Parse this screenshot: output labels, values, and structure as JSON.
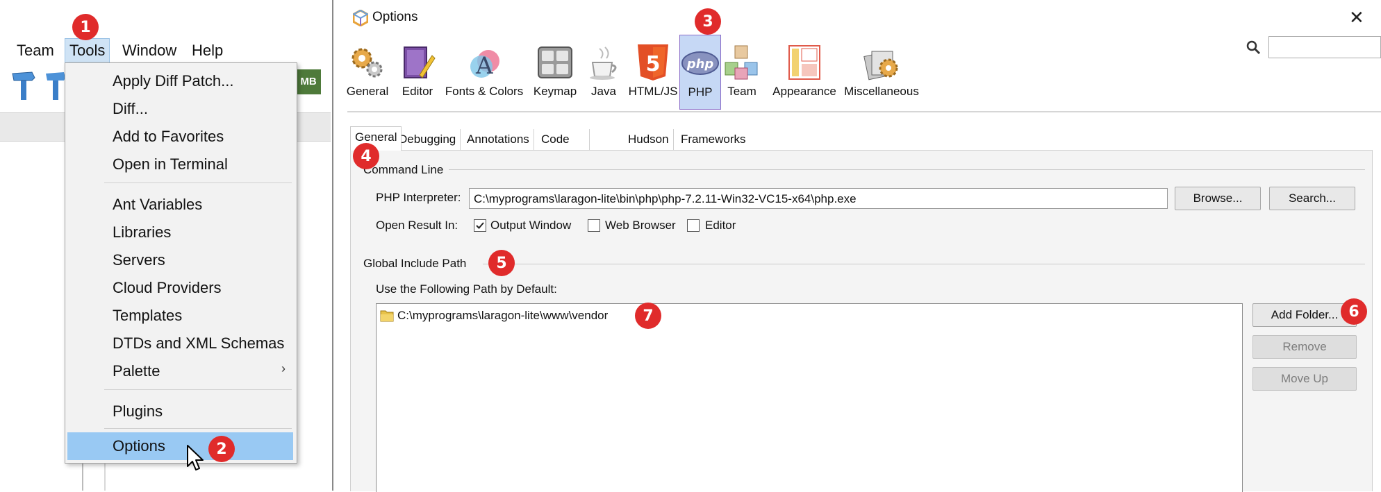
{
  "menubar": {
    "items": [
      "Team",
      "Tools",
      "Window",
      "Help"
    ],
    "active": "Tools"
  },
  "tools_menu": {
    "groups": [
      [
        "Apply Diff Patch...",
        "Diff...",
        "Add to Favorites",
        "Open in Terminal"
      ],
      [
        "Ant Variables",
        "Libraries",
        "Servers",
        "Cloud Providers",
        "Templates",
        "DTDs and XML Schemas",
        "Palette"
      ],
      [
        "Plugins"
      ],
      [
        "Options"
      ]
    ],
    "submenu_arrow": "›",
    "selected": "Options"
  },
  "toolbar": {
    "memory_label": "MB"
  },
  "dialog": {
    "title": "Options",
    "close": "✕",
    "categories": [
      "General",
      "Editor",
      "Fonts & Colors",
      "Keymap",
      "Java",
      "HTML/JS",
      "PHP",
      "Team",
      "Appearance",
      "Miscellaneous"
    ],
    "active_category": "PHP",
    "html5_icon_text": "5",
    "php_icon_text": "php",
    "search": {
      "placeholder": ""
    }
  },
  "php_tabs": {
    "items": [
      "General",
      "Debugging",
      "Annotations",
      "Code Analysis",
      "Hudson",
      "Frameworks & Tools"
    ],
    "active": "General"
  },
  "command_line": {
    "section_title": "Command Line",
    "interpreter_label": "PHP Interpreter:",
    "interpreter_value": "C:\\myprograms\\laragon-lite\\bin\\php\\php-7.2.11-Win32-VC15-x64\\php.exe",
    "browse_button": "Browse...",
    "search_button": "Search...",
    "open_result_label": "Open Result In:",
    "options": [
      {
        "label": "Output Window",
        "checked": true
      },
      {
        "label": "Web Browser",
        "checked": false
      },
      {
        "label": "Editor",
        "checked": false
      }
    ]
  },
  "include_path": {
    "section_title": "Global Include Path",
    "default_label": "Use the Following Path by Default:",
    "paths": [
      "C:\\myprograms\\laragon-lite\\www\\vendor"
    ],
    "add_folder_button": "Add Folder...",
    "remove_button": "Remove",
    "move_up_button": "Move Up"
  },
  "callouts": [
    "1",
    "2",
    "3",
    "4",
    "5",
    "6",
    "7"
  ],
  "colors": {
    "callout": "#e02b2b",
    "menu_highlight": "#99c9f3",
    "active_category_bg": "#c6d8f5"
  }
}
